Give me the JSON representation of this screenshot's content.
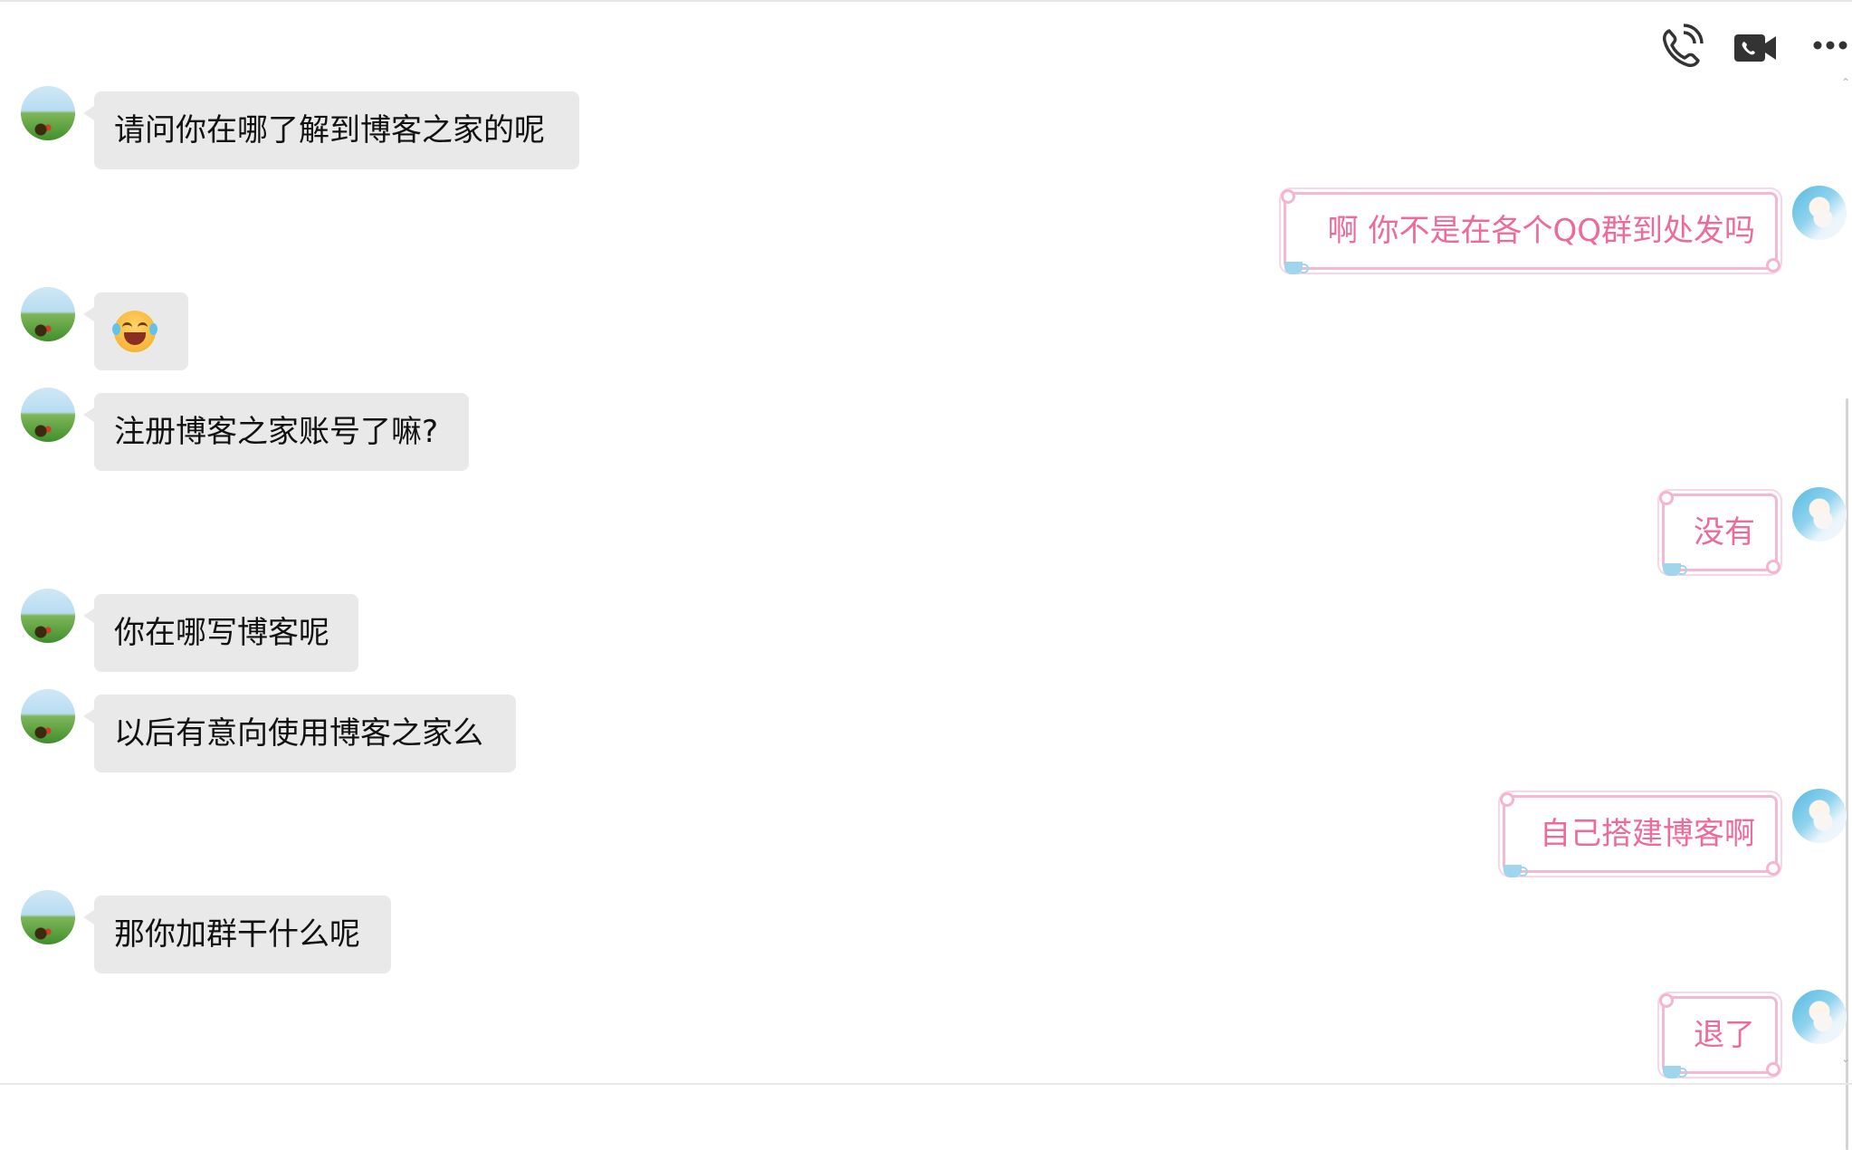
{
  "toolbar": {
    "icons": [
      "phone-icon",
      "video-camera-icon",
      "more-icon"
    ]
  },
  "messages": [
    {
      "side": "friend",
      "type": "text",
      "text": "请问你在哪了解到博客之家的呢"
    },
    {
      "side": "me",
      "type": "text",
      "text": "啊 你不是在各个QQ群到处发吗"
    },
    {
      "side": "friend",
      "type": "emoji",
      "emoji": "laughing-with-tears-emoji"
    },
    {
      "side": "friend",
      "type": "text",
      "text": "注册博客之家账号了嘛?"
    },
    {
      "side": "me",
      "type": "text",
      "text": "没有"
    },
    {
      "side": "friend",
      "type": "text",
      "text": "你在哪写博客呢"
    },
    {
      "side": "friend",
      "type": "text",
      "text": "以后有意向使用博客之家么"
    },
    {
      "side": "me",
      "type": "text",
      "text": "自己搭建博客啊"
    },
    {
      "side": "friend",
      "type": "text",
      "text": "那你加群干什么呢"
    },
    {
      "side": "me",
      "type": "text",
      "text": "退了"
    }
  ],
  "colors": {
    "friend_bubble": "#e9e9e9",
    "me_bubble_border": "#f4b8d2",
    "me_text": "#ec6b9c"
  }
}
